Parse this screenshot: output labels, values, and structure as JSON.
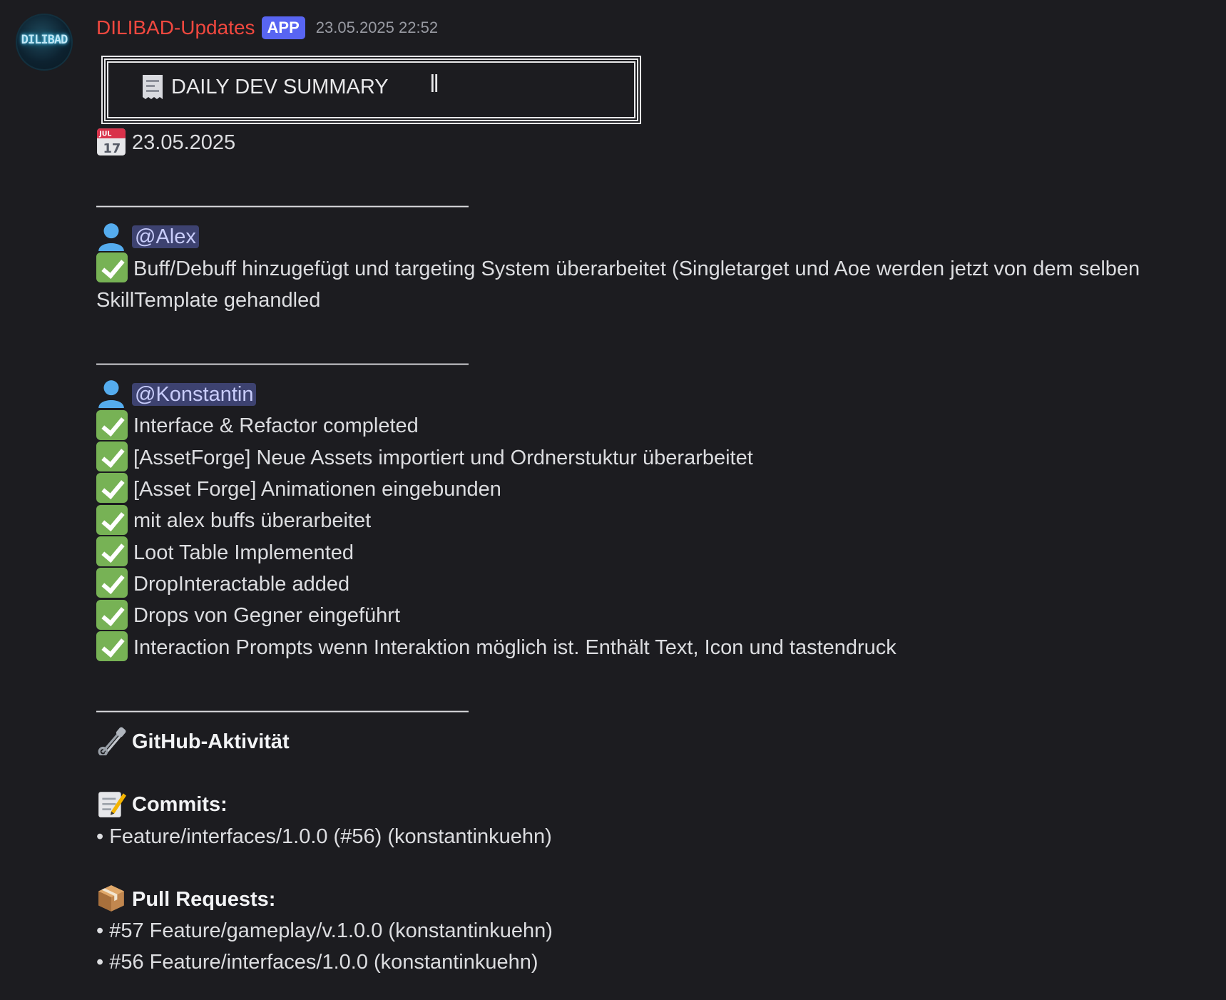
{
  "message": {
    "author": "DILIBAD-Updates",
    "badge": "APP",
    "timestamp": "23.05.2025 22:52",
    "avatar_text": "DILIBAD"
  },
  "banner": {
    "title": "DAILY DEV SUMMARY",
    "trailing_bar": "‖",
    "icon": "receipt-icon"
  },
  "date": {
    "icon": "calendar-icon",
    "text": "23.05.2025"
  },
  "divider": "——————————————————",
  "sections": [
    {
      "user": "@Alex",
      "items": [
        "Buff/Debuff hinzugefügt und targeting System überarbeitet (Singletarget und Aoe werden jetzt von dem selben SkillTemplate gehandled"
      ]
    },
    {
      "user": "@Konstantin",
      "items": [
        "Interface & Refactor completed",
        "[AssetForge] Neue Assets importiert und Ordnerstuktur überarbeitet",
        "[Asset Forge] Animationen eingebunden",
        "mit alex buffs überarbeitet",
        "Loot Table Implemented",
        "DropInteractable added",
        "Drops von Gegner eingeführt",
        "Interaction Prompts wenn Interaktion möglich ist. Enthält Text, Icon und tastendruck"
      ]
    }
  ],
  "github": {
    "heading": "GitHub-Aktivität",
    "commits_heading": "Commits:",
    "commits": [
      "Feature/interfaces/1.0.0 (#56) (konstantinkuehn)"
    ],
    "pr_heading": "Pull Requests:",
    "pull_requests": [
      "#57 Feature/gameplay/v.1.0.0 (konstantinkuehn)",
      "#56 Feature/interfaces/1.0.0 (konstantinkuehn)"
    ]
  },
  "colors": {
    "background": "#1c1c20",
    "author": "#f0483f",
    "badge": "#5865f2",
    "mention_bg": "#3d4270",
    "check": "#77b255"
  }
}
